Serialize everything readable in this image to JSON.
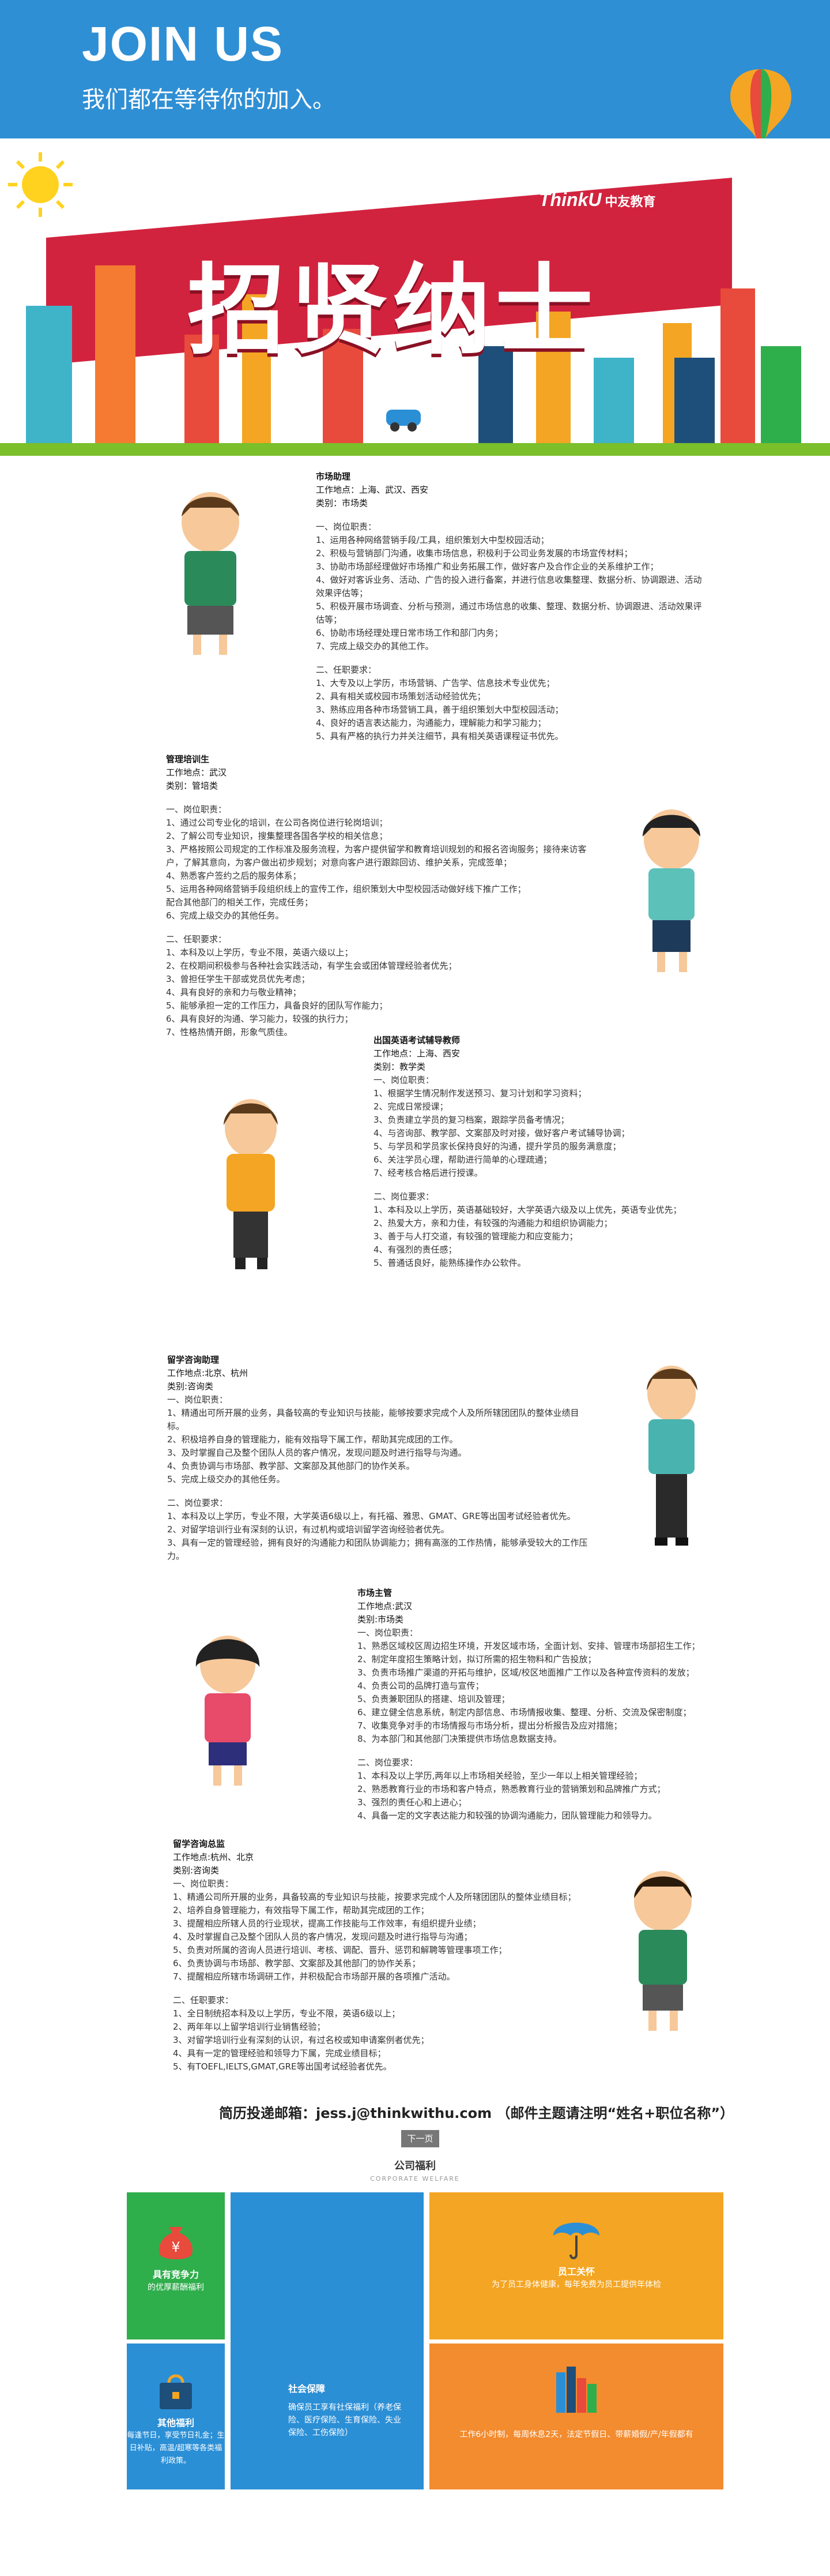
{
  "header": {
    "title": "JOIN US",
    "subtitle": "我们都在等待你的加入。"
  },
  "hero": {
    "banner_title": "招贤纳士",
    "logo_brand": "ThinkU",
    "logo_cn": "中友教育"
  },
  "jobs": [
    {
      "title": "市场助理",
      "location": "工作地点：上海、武汉、西安",
      "category": "类别：市场类",
      "duty_head": "一、岗位职责：",
      "duties": [
        "1、运用各种网络营销手段/工具，组织策划大中型校园活动；",
        "2、积极与营销部门沟通，收集市场信息，积极利于公司业务发展的市场宣传材料；",
        "3、协助市场部经理做好市场推广和业务拓展工作，做好客户及合作企业的关系维护工作；",
        "4、做好对客诉业务、活动、广告的投入进行备案，并进行信息收集整理、数据分析、协调跟进、活动效果评估等；",
        "5、积极开展市场调查、分析与预测，通过市场信息的收集、整理、数据分析、协调跟进、活动效果评估等；",
        "6、协助市场经理处理日常市场工作和部门内务；",
        "7、完成上级交办的其他工作。"
      ],
      "req_head": "二、任职要求：",
      "reqs": [
        "1、大专及以上学历，市场营销、广告学、信息技术专业优先；",
        "2、具有相关或校园市场策划活动经验优先；",
        "3、熟练应用各种市场营销工具，善于组织策划大中型校园活动；",
        "4、良好的语言表达能力，沟通能力，理解能力和学习能力；",
        "5、具有严格的执行力并关注细节，具有相关英语课程证书优先。"
      ]
    },
    {
      "title": "管理培训生",
      "location": "工作地点：武汉",
      "category": "类别：管培类",
      "duty_head": "一、岗位职责：",
      "duties": [
        "1、通过公司专业化的培训，在公司各岗位进行轮岗培训；",
        "2、了解公司专业知识，搜集整理各国各学校的相关信息；",
        "3、严格按照公司规定的工作标准及服务流程，为客户提供留学和教育培训规划的和报名咨询服务；接待来访客户，了解其意向，为客户做出初步规划；对意向客户进行跟踪回访、维护关系，完成签单；",
        "4、熟悉客户签约之后的服务体系；",
        "5、运用各种网络营销手段组织线上的宣传工作，组织策划大中型校园活动做好线下推广工作；",
        "配合其他部门的相关工作，完成任务；",
        "6、完成上级交办的其他任务。"
      ],
      "req_head": "二、任职要求：",
      "reqs": [
        "1、本科及以上学历，专业不限，英语六级以上；",
        "2、在校期间积极参与各种社会实践活动，有学生会或团体管理经验者优先；",
        "3、曾担任学生干部或党员优先考虑；",
        "4、具有良好的亲和力与敬业精神；",
        "5、能够承担一定的工作压力，具备良好的团队写作能力；",
        "6、具有良好的沟通、学习能力，较强的执行力；",
        "7、性格热情开朗，形象气质佳。"
      ]
    },
    {
      "title": "出国英语考试辅导教师",
      "location": "工作地点：上海、西安",
      "category": "类别：教学类",
      "duty_head": "一、岗位职责：",
      "duties": [
        "1、根据学生情况制作发送预习、复习计划和学习资料；",
        "2、完成日常授课；",
        "3、负责建立学员的复习档案，跟踪学员备考情况；",
        "4、与咨询部、教学部、文案部及时对接，做好客户考试辅导协调；",
        "5、与学员和学员家长保持良好的沟通，提升学员的服务满意度；",
        "6、关注学员心理，帮助进行简单的心理疏通；",
        "7、经考核合格后进行授课。"
      ],
      "req_head": "二、岗位要求：",
      "reqs": [
        "1、本科及以上学历，英语基础较好，大学英语六级及以上优先，英语专业优先；",
        "2、热爱大方，亲和力佳，有较强的沟通能力和组织协调能力；",
        "3、善于与人打交道，有较强的管理能力和应变能力；",
        "4、有强烈的责任感；",
        "5、普通话良好，能熟练操作办公软件。"
      ]
    },
    {
      "title": "留学咨询助理",
      "location": "工作地点:北京、杭州",
      "category": "类别:咨询类",
      "duty_head": "一、岗位职责：",
      "duties": [
        "1、精通出可所开展的业务，具备较高的专业知识与技能，能够按要求完成个人及所所辖团团队的整体业绩目标。",
        "2、积极培养自身的管理能力，能有效指导下属工作，帮助其完成团的工作。",
        "3、及时掌握自己及整个团队人员的客户情况，发现问题及时进行指导与沟通。",
        "4、负责协调与市场部、教学部、文案部及其他部门的协作关系。",
        "5、完成上级交办的其他任务。"
      ],
      "req_head": "二、岗位要求：",
      "reqs": [
        "1、本科及以上学历，专业不限，大学英语6级以上，有托福、雅思、GMAT、GRE等出国考试经验者优先。",
        "2、对留学培训行业有深刻的认识，有过机构或培训留学咨询经验者优先。",
        "3、具有一定的管理经验，拥有良好的沟通能力和团队协调能力；拥有高涨的工作热情，能够承受较大的工作压力。"
      ]
    },
    {
      "title": "市场主管",
      "location": "工作地点:武汉",
      "category": "类别:市场类",
      "duty_head": "一、岗位职责：",
      "duties": [
        "1、熟悉区域校区周边招生环境，开发区域市场，全面计划、安排、管理市场部招生工作；",
        "2、制定年度招生策略计划，拟订所需的招生物料和广告投放；",
        "3、负责市场推广渠道的开拓与维护，区域/校区地面推广工作以及各种宣传资料的发放；",
        "4、负责公司的品牌打造与宣传；",
        "5、负责兼职团队的搭建、培训及管理；",
        "6、建立健全信息系统，制定内部信息、市场情报收集、整理、分析、交流及保密制度；",
        "7、收集竞争对手的市场情报与市场分析，提出分析报告及应对措施；",
        "8、为本部门和其他部门决策提供市场信息数据支持。"
      ],
      "req_head": "二、岗位要求：",
      "reqs": [
        "1、本科及以上学历,两年以上市场相关经验，至少一年以上相关管理经验；",
        "2、熟悉教育行业的市场和客户特点，熟悉教育行业的营销策划和品牌推广方式；",
        "3、强烈的责任心和上进心；",
        "4、具备一定的文字表达能力和较强的协调沟通能力，团队管理能力和领导力。"
      ]
    },
    {
      "title": "留学咨询总监",
      "location": "工作地点:杭州、北京",
      "category": "类别:咨询类",
      "duty_head": "一、岗位职责：",
      "duties": [
        "1、精通公司所开展的业务，具备较高的专业知识与技能，按要求完成个人及所辖团团队的整体业绩目标；",
        "2、培养自身管理能力，有效指导下属工作，帮助其完成团的工作；",
        "3、提醒相应所辖人员的行业现状，提高工作技能与工作效率，有组织提升业绩；",
        "4、及时掌握自己及整个团队人员的客户情况，发现问题及时进行指导与沟通；",
        "5、负责对所属的咨询人员进行培训、考核、调配、晋升、惩罚和解聘等管理事项工作；",
        "6、负责协调与市场部、教学部、文案部及其他部门的协作关系；",
        "7、提醒相应所辖市场调研工作，并积极配合市场部开展的各项推广活动。"
      ],
      "req_head": "二、任职要求：",
      "reqs": [
        "1、全日制统招本科及以上学历，专业不限，英语6级以上；",
        "2、两年年以上留学培训行业销售经验；",
        "3、对留学培训行业有深刻的认识，有过名校或知申请案例者优先；",
        "4、具有一定的管理经验和领导力下属，完成业绩目标；",
        "5、有TOEFL,IELTS,GMAT,GRE等出国考试经验者优先。"
      ]
    }
  ],
  "footer": {
    "email_line": "简历投递邮箱：jess.j@thinkwithu.com （邮件主题请注明“姓名+职位名称”）",
    "next_button": "下一页",
    "welfare_title": "公司福利",
    "welfare_sub": "CORPORATE WELFARE"
  },
  "welfare": [
    {
      "title": "具有竞争力",
      "desc": "的优厚薪酬福利",
      "color": "#2fae4c",
      "icon": "money-bag-icon"
    },
    {
      "title": "社会保障",
      "desc": "确保员工享有社保福利（养老保险、医疗保险、生育保险、失业保险、工伤保险）",
      "color": "#2b8fd6",
      "icon": "none"
    },
    {
      "title": "员工关怀",
      "desc": "为了员工身体健康，每年免费为员工提供年体检",
      "color": "#f4a523",
      "icon": "umbrella-icon"
    },
    {
      "title": "其他福利",
      "desc": "每逢节日，享受节日礼金；生日补贴，高温/超寒等各类福利政策。",
      "color": "#2b8fd6",
      "icon": "gift-bag-icon"
    },
    {
      "title": "",
      "desc": "工作6小时制，每周休息2天，法定节假日、带薪婚假/产/年假都有",
      "color": "#f38b2f",
      "icon": "books-icon"
    }
  ]
}
